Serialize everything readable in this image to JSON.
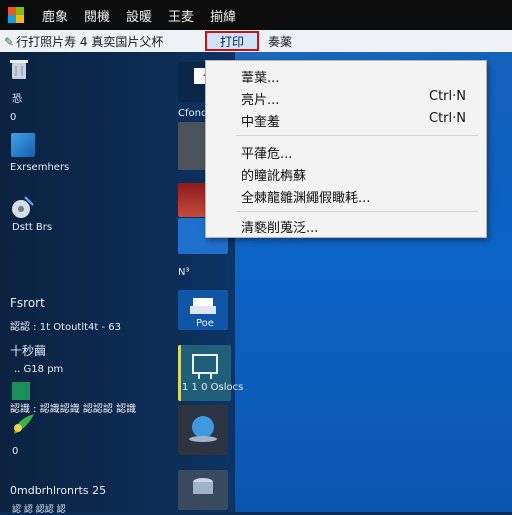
{
  "menubar": {
    "items": [
      "鹿象",
      "閱機",
      "設暖",
      "王麦",
      "揃緯"
    ]
  },
  "toolbar": {
    "path": "行打照片寿  4  真奕国片父杯",
    "print_tab": "打印",
    "next": "奏薬"
  },
  "dropdown": {
    "items": [
      {
        "label": "葦葉...",
        "shortcut": ""
      },
      {
        "label": "亮片...",
        "shortcut": "Ctrl·N"
      },
      {
        "label": "中奎羞",
        "shortcut": "Ctrl·N"
      },
      {
        "label": "平葎危...",
        "shortcut": ""
      },
      {
        "label": "的瞳訛栴蘇",
        "shortcut": ""
      },
      {
        "label": "全棘龍雛渊繩假瞰耗...",
        "shortcut": ""
      },
      {
        "label": "清褻削蒐泛...",
        "shortcut": ""
      }
    ]
  },
  "desktop": {
    "labels": {
      "l1": "恐",
      "l2": "0",
      "l3": "Exrsemhers",
      "l4": "Dstt Brs",
      "l5": "Fsrort",
      "l6": "認認 : 1t Otoutlt4t - 63",
      "l7": "十秒繭",
      "l8": "..  G18 pm",
      "l9": "認識 : 認識認識 認認認 認識",
      "l10": "0",
      "l11": "0mdbrhlronrts 25",
      "l12": "認 認  認認  認",
      "r1": "Cfondlte",
      "r2": "N³",
      "r3": "Poe",
      "r4": "1 1 0 Oslocs"
    }
  }
}
